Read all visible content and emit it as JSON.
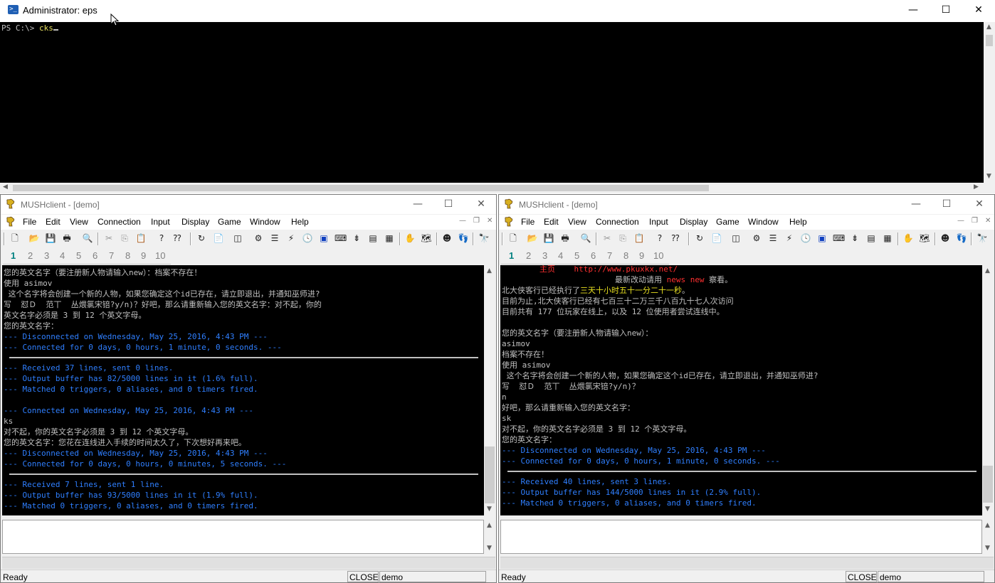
{
  "powershell": {
    "title": "Administrator: eps",
    "prompt": "PS C:\\> ",
    "command": "cks",
    "controls": {
      "minimize": "—",
      "maximize": "☐",
      "close": "✕"
    }
  },
  "left": {
    "title": "MUSHclient - [demo]",
    "menu": [
      "File",
      "Edit",
      "View",
      "Connection",
      "Input",
      "Display",
      "Game",
      "Window",
      "Help"
    ],
    "world_tabs": [
      "1",
      "2",
      "3",
      "4",
      "5",
      "6",
      "7",
      "8",
      "9",
      "10"
    ],
    "output": [
      {
        "t": "您的英文名字（要注册新人物请输入new）：档案不存在！",
        "c": "w"
      },
      {
        "t": "使用 asimov",
        "c": "w"
      },
      {
        "t": " 这个名字将会创建一个新的人物，如果您确定这个id已存在，请立即退出，并通知巫师进?",
        "c": "w"
      },
      {
        "t": "写  怼Ｄ  范丅  丛煨氯宋锫?y/n)？好吧，那么请重新输入您的英文名字：对不起，你的",
        "c": "w"
      },
      {
        "t": "英文名字必须是 3 到 12 个英文字母。",
        "c": "w"
      },
      {
        "t": "您的英文名字：",
        "c": "w"
      },
      {
        "t": "--- Disconnected on Wednesday, May 25, 2016, 4:43 PM ---",
        "c": "b"
      },
      {
        "t": "--- Connected for 0 days, 0 hours, 1 minute, 0 seconds. ---",
        "c": "b"
      },
      {
        "t": "",
        "c": "hr"
      },
      {
        "t": "--- Received 37 lines, sent 0 lines.",
        "c": "b"
      },
      {
        "t": "--- Output buffer has 82/5000 lines in it (1.6% full).",
        "c": "b"
      },
      {
        "t": "--- Matched 0 triggers, 0 aliases, and 0 timers fired.",
        "c": "b"
      },
      {
        "t": "",
        "c": "w"
      },
      {
        "t": "--- Connected on Wednesday, May 25, 2016, 4:43 PM ---",
        "c": "b"
      },
      {
        "t": "ks",
        "c": "w"
      },
      {
        "t": "对不起，你的英文名字必须是 3 到 12 个英文字母。",
        "c": "w"
      },
      {
        "t": "您的英文名字：您花在连线进入手续的时间太久了，下次想好再来吧。",
        "c": "w"
      },
      {
        "t": "--- Disconnected on Wednesday, May 25, 2016, 4:43 PM ---",
        "c": "b"
      },
      {
        "t": "--- Connected for 0 days, 0 hours, 0 minutes, 5 seconds. ---",
        "c": "b"
      },
      {
        "t": "",
        "c": "hr"
      },
      {
        "t": "--- Received 7 lines, sent 1 line.",
        "c": "b"
      },
      {
        "t": "--- Output buffer has 93/5000 lines in it (1.9% full).",
        "c": "b"
      },
      {
        "t": "--- Matched 0 triggers, 0 aliases, and 0 timers fired.",
        "c": "b"
      }
    ],
    "status": {
      "ready": "Ready",
      "closed": "CLOSED",
      "world": "demo"
    }
  },
  "right": {
    "title": "MUSHclient - [demo]",
    "menu": [
      "File",
      "Edit",
      "View",
      "Connection",
      "Input",
      "Display",
      "Game",
      "Window",
      "Help"
    ],
    "world_tabs": [
      "1",
      "2",
      "3",
      "4",
      "5",
      "6",
      "7",
      "8",
      "9",
      "10"
    ],
    "output": [
      {
        "t": "        主页    http://www.pkuxkx.net/",
        "c": "link"
      },
      {
        "t": "",
        "c": "news"
      },
      {
        "t": "北大侠客行已经执行了三天十小时五十一分二十一秒。",
        "c": "uptime"
      },
      {
        "t": "目前为止,北大侠客行已经有七百三十二万三千八百九十七人次访问",
        "c": "w"
      },
      {
        "t": "目前共有 177 位玩家在线上，以及 12 位使用者尝试连线中。",
        "c": "w"
      },
      {
        "t": "",
        "c": "w"
      },
      {
        "t": "您的英文名字（要注册新人物请输入new）：",
        "c": "w"
      },
      {
        "t": "asimov",
        "c": "w"
      },
      {
        "t": "档案不存在！",
        "c": "w"
      },
      {
        "t": "使用 asimov",
        "c": "w"
      },
      {
        "t": " 这个名字将会创建一个新的人物，如果您确定这个id已存在，请立即退出，并通知巫师进?",
        "c": "w"
      },
      {
        "t": "写  怼Ｄ  范丅  丛煨氯宋锫?y/n)？",
        "c": "w"
      },
      {
        "t": "n",
        "c": "w"
      },
      {
        "t": "好吧，那么请重新输入您的英文名字：",
        "c": "w"
      },
      {
        "t": "sk",
        "c": "w"
      },
      {
        "t": "对不起，你的英文名字必须是 3 到 12 个英文字母。",
        "c": "w"
      },
      {
        "t": "您的英文名字：",
        "c": "w"
      },
      {
        "t": "--- Disconnected on Wednesday, May 25, 2016, 4:43 PM ---",
        "c": "b"
      },
      {
        "t": "--- Connected for 0 days, 0 hours, 1 minute, 0 seconds. ---",
        "c": "b"
      },
      {
        "t": "",
        "c": "hr"
      },
      {
        "t": "--- Received 40 lines, sent 3 lines.",
        "c": "b"
      },
      {
        "t": "--- Output buffer has 144/5000 lines in it (2.9% full).",
        "c": "b"
      },
      {
        "t": "--- Matched 0 triggers, 0 aliases, and 0 timers fired.",
        "c": "b"
      }
    ],
    "news_line": {
      "pre": "最新改动请用 ",
      "cmd": "news new",
      "post": " 察看。"
    },
    "uptime_line": {
      "pre": "北大侠客行已经执行了",
      "dur": "三天十小时五十一分二十一秒",
      "post": "。"
    },
    "status": {
      "ready": "Ready",
      "closed": "CLOSED",
      "world": "demo"
    }
  },
  "colors": {
    "console_bg": "#000000",
    "info_blue": "#2f7fff",
    "text": "#c0c0c0",
    "highlight_yellow": "#e8e020",
    "news_red": "#ff3030",
    "tab_active": "#008080"
  },
  "toolbar_icons": [
    "new-icon",
    "open-icon",
    "save-icon",
    "print-icon",
    "print-preview-icon",
    "cut-icon",
    "copy-icon",
    "paste-icon",
    "help-icon",
    "context-help-icon",
    "reconnect-icon",
    "log-icon",
    "split-icon",
    "configure-icon",
    "commands-icon",
    "triggers-icon",
    "timers-icon",
    "output-window-icon",
    "scroll-icon",
    "notepad-icon",
    "info-icon",
    "table-icon",
    "activity-icon",
    "mapper-icon",
    "plugins-icon",
    "speedwalk-icon",
    "find-icon"
  ]
}
